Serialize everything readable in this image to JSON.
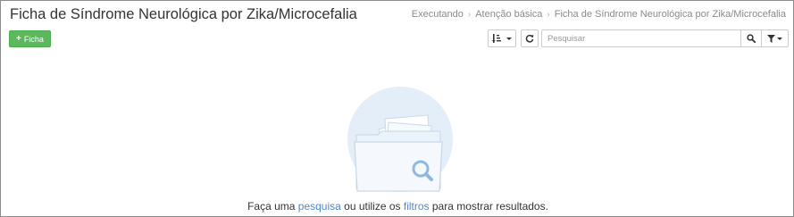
{
  "header": {
    "title": "Ficha de Síndrome Neurológica por Zika/Microcefalia",
    "breadcrumb": [
      "Executando",
      "Atenção básica",
      "Ficha de Síndrome Neurológica por Zika/Microcefalia"
    ]
  },
  "toolbar": {
    "add_label": "Ficha",
    "search_placeholder": "Pesquisar",
    "icons": {
      "add": "plus-icon",
      "sort": "sort-icon",
      "refresh": "refresh-icon",
      "search": "search-icon",
      "filter": "filter-icon"
    }
  },
  "empty_state": {
    "text_before": "Faça uma ",
    "link_search": "pesquisa",
    "text_middle": " ou utilize os ",
    "link_filters": "filtros",
    "text_after": " para mostrar resultados."
  },
  "colors": {
    "accent_green": "#5cb85c",
    "link_blue": "#4f88c2",
    "illustration_circle": "#e3eef9"
  }
}
